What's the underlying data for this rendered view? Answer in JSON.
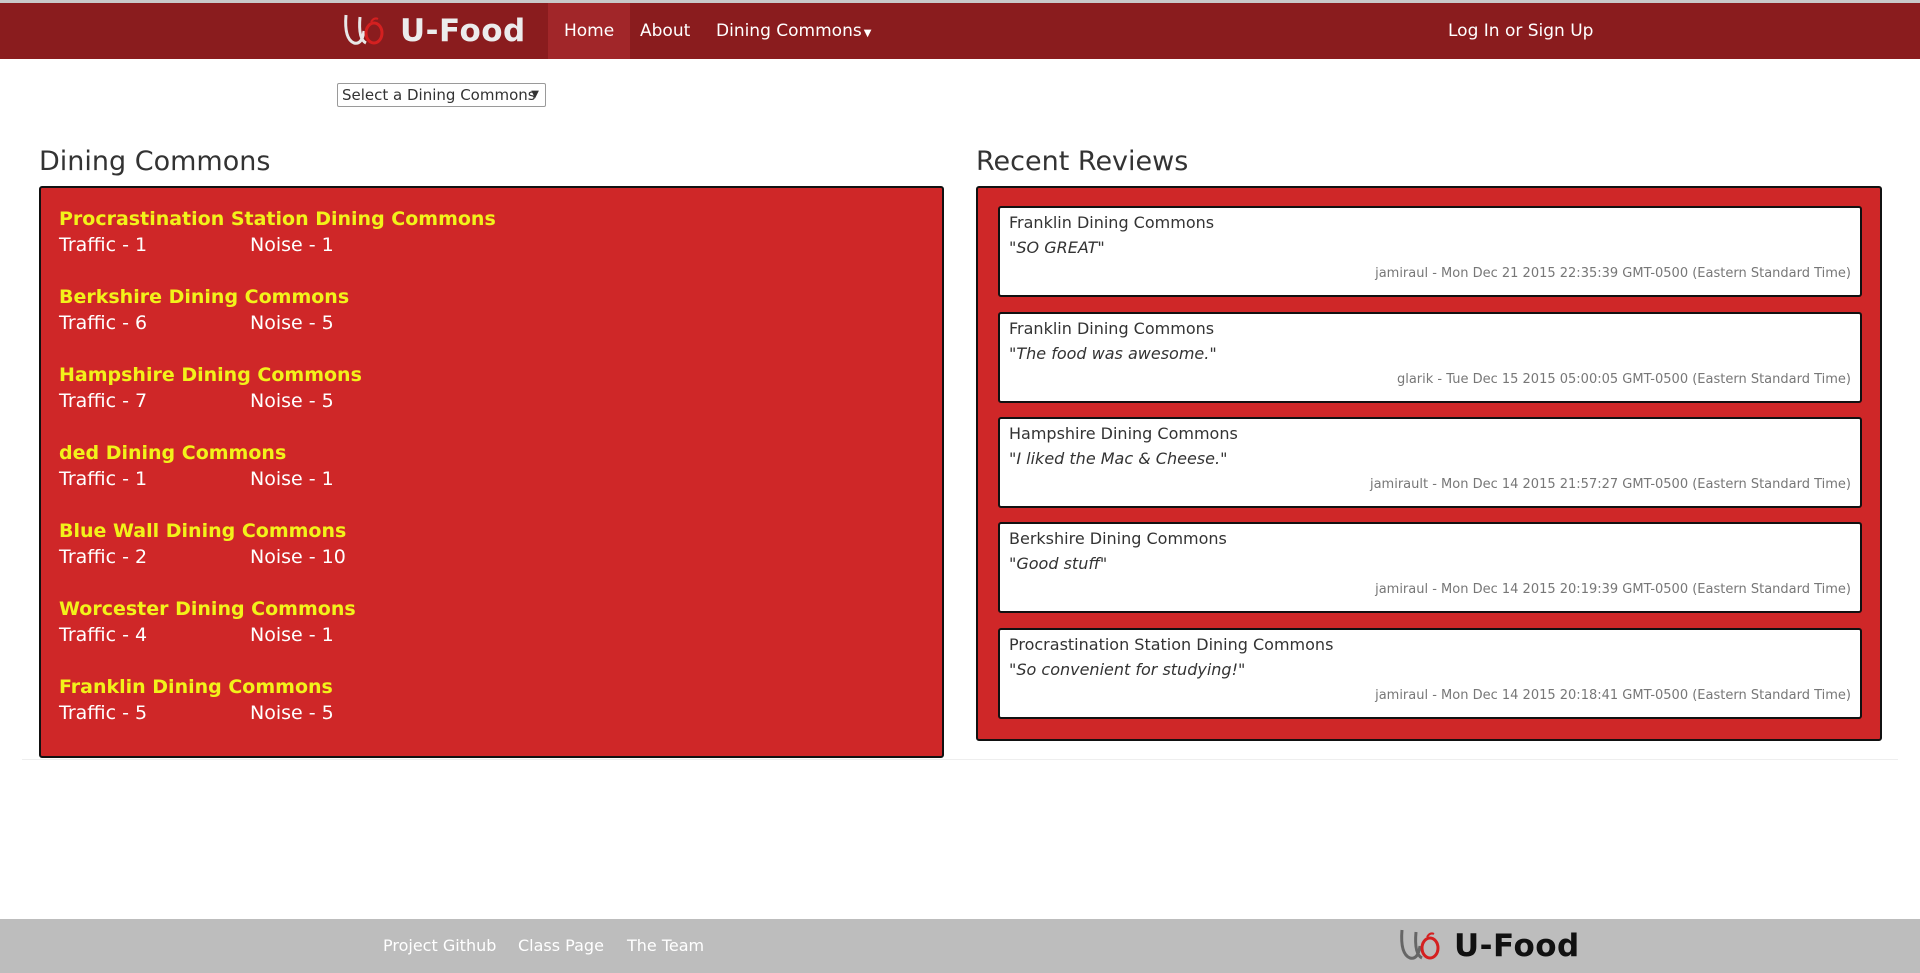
{
  "brand": {
    "name": "U-Food"
  },
  "nav": {
    "home": "Home",
    "about": "About",
    "dining": "Dining Commons",
    "login": "Log In or Sign Up"
  },
  "select": {
    "label": "Select a Dining Commons"
  },
  "dining_section": {
    "title": "Dining Commons",
    "items": [
      {
        "name": "Procrastination Station Dining Commons",
        "traffic": "Traffic - 1",
        "noise": "Noise - 1"
      },
      {
        "name": "Berkshire Dining Commons",
        "traffic": "Traffic - 6",
        "noise": "Noise - 5"
      },
      {
        "name": "Hampshire Dining Commons",
        "traffic": "Traffic - 7",
        "noise": "Noise - 5"
      },
      {
        "name": "ded Dining Commons",
        "traffic": "Traffic - 1",
        "noise": "Noise - 1"
      },
      {
        "name": "Blue Wall Dining Commons",
        "traffic": "Traffic - 2",
        "noise": "Noise - 10"
      },
      {
        "name": "Worcester Dining Commons",
        "traffic": "Traffic - 4",
        "noise": "Noise - 1"
      },
      {
        "name": "Franklin Dining Commons",
        "traffic": "Traffic - 5",
        "noise": "Noise - 5"
      }
    ]
  },
  "reviews_section": {
    "title": "Recent Reviews",
    "items": [
      {
        "dining": "Franklin Dining Commons",
        "text": "\"SO GREAT\"",
        "meta": "jamiraul - Mon Dec 21 2015 22:35:39 GMT-0500 (Eastern Standard Time)"
      },
      {
        "dining": "Franklin Dining Commons",
        "text": "\"The food was awesome.\"",
        "meta": "glarik - Tue Dec 15 2015 05:00:05 GMT-0500 (Eastern Standard Time)"
      },
      {
        "dining": "Hampshire Dining Commons",
        "text": "\"I liked the Mac & Cheese.\"",
        "meta": "jamirault - Mon Dec 14 2015 21:57:27 GMT-0500 (Eastern Standard Time)"
      },
      {
        "dining": "Berkshire Dining Commons",
        "text": "\"Good stuff\"",
        "meta": "jamiraul - Mon Dec 14 2015 20:19:39 GMT-0500 (Eastern Standard Time)"
      },
      {
        "dining": "Procrastination Station Dining Commons",
        "text": "\"So convenient for studying!\"",
        "meta": "jamiraul - Mon Dec 14 2015 20:18:41 GMT-0500 (Eastern Standard Time)"
      }
    ]
  },
  "footer": {
    "github": "Project Github",
    "class_page": "Class Page",
    "team": "The Team",
    "brand": "U-Food"
  },
  "colors": {
    "navbar": "#8a1c1e",
    "nav_active": "#a12629",
    "panel_red": "#cf2728",
    "dining_name_yellow": "#f2f21a",
    "footer": "#bdbdbd"
  }
}
